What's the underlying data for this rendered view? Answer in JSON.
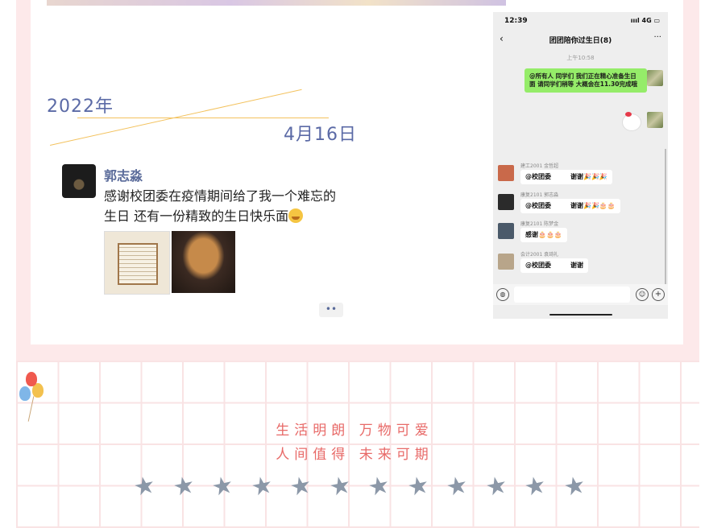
{
  "date": {
    "year": "2022年",
    "day": "4月16日"
  },
  "post": {
    "author": "郭志淼",
    "text": "感谢校团委在疫情期间给了我一个难忘的生日 还有一份精致的生日快乐面",
    "more": "••"
  },
  "phone": {
    "time": "12:39",
    "signal": "4G",
    "chat_title": "团团陪你过生日(8)",
    "back_icon": "‹",
    "menu_icon": "···",
    "msg_time": "上午10:58",
    "announcement": "@所有人 同学们 我们正在精心准备生日面 请同学们稍等 大概会在11.30完成哦",
    "messages": [
      {
        "sender": "建工2001 金哲超",
        "mention": "@校团委",
        "reply": "谢谢",
        "deco": "🎉🎉🎉",
        "avatar_color": "#c9694a"
      },
      {
        "sender": "康复2101 郭志淼",
        "mention": "@校团委",
        "reply": "谢谢",
        "deco": "🎉🎉🎂🎂",
        "avatar_color": "#2b2b2b"
      },
      {
        "sender": "康复2101 陈梦金",
        "mention": "感谢",
        "reply": "",
        "deco": "🎂🎂🎂",
        "avatar_color": "#4b5a6a"
      },
      {
        "sender": "会计2001 袁琦礼",
        "mention": "@校团委",
        "reply": "谢谢",
        "deco": "",
        "avatar_color": "#b8a58a"
      }
    ]
  },
  "slogan": {
    "line1": "生活明朗 万物可爱",
    "line2": "人间值得 未来可期"
  },
  "stars": [
    "★",
    "★",
    "★",
    "★",
    "★",
    "★",
    "★",
    "★",
    "★",
    "★",
    "★",
    "★"
  ]
}
